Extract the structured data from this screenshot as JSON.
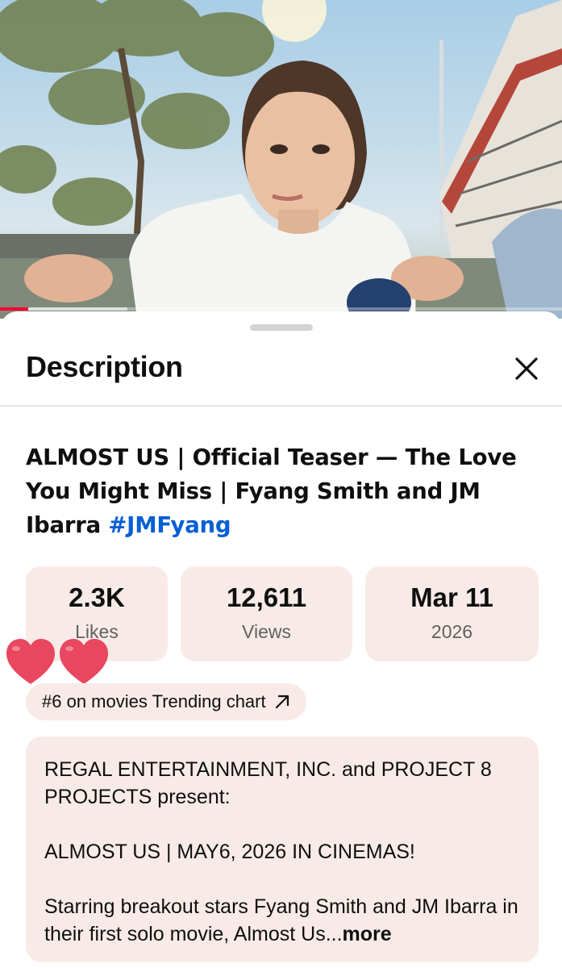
{
  "sheet": {
    "title": "Description",
    "close_icon": "close-icon"
  },
  "video": {
    "title_text": "ALMOST US | Official Teaser — The Love You Might Miss | Fyang Smith and JM Ibarra ",
    "hashtag": "#JMFyang",
    "progress_fraction": 0.05
  },
  "stats": {
    "likes": {
      "value": "2.3K",
      "label": "Likes"
    },
    "views": {
      "value": "12,611",
      "label": "Views"
    },
    "date": {
      "value": "Mar 11",
      "label": "2026"
    }
  },
  "trending": {
    "label": "#6 on movies Trending chart",
    "icon": "arrow-up-right-icon"
  },
  "description": {
    "line1": "REGAL ENTERTAINMENT, INC. and PROJECT 8 PROJECTS present:",
    "line2": "ALMOST US | MAY6, 2026 IN CINEMAS!",
    "line3": "Starring breakout stars Fyang Smith and JM Ibarra in their first solo movie, Almost Us...",
    "more_label": "more"
  },
  "colors": {
    "accent_link": "#065fd4",
    "card_bg": "#f8ebe7",
    "progress_red": "#ff0033",
    "heart": "#e8475f"
  }
}
